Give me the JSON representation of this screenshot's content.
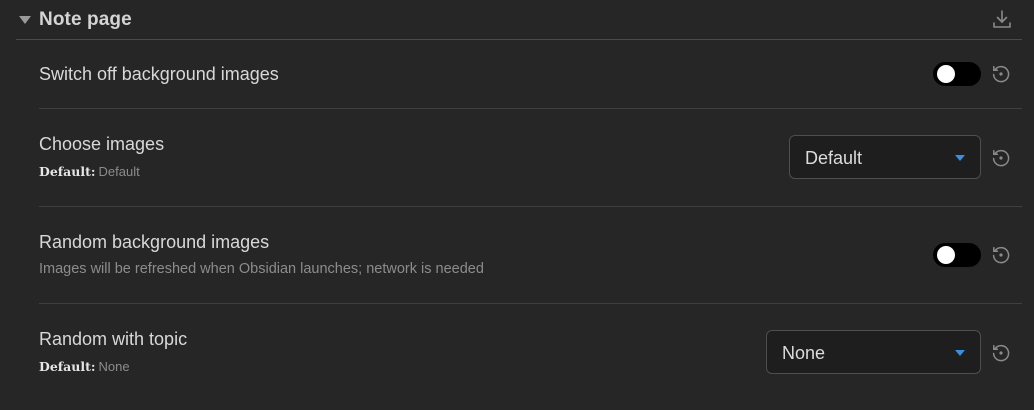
{
  "section": {
    "title": "Note page",
    "collapse_icon": "caret-down-icon",
    "export_icon": "download-icon"
  },
  "settings": [
    {
      "name": "Switch off background images",
      "control": "toggle",
      "enabled": false,
      "reset_icon": "reset-icon"
    },
    {
      "name": "Choose images",
      "default_label": "Default:",
      "default_value": "Default",
      "control": "dropdown",
      "selected": "Default",
      "reset_icon": "reset-icon"
    },
    {
      "name": "Random background images",
      "description": "Images will be refreshed when Obsidian launches; network is needed",
      "control": "toggle",
      "enabled": false,
      "reset_icon": "reset-icon"
    },
    {
      "name": "Random with topic",
      "default_label": "Default:",
      "default_value": "None",
      "control": "dropdown",
      "selected": "None",
      "reset_icon": "reset-icon"
    }
  ],
  "colors": {
    "background": "#262626",
    "toggle_off": "#000000",
    "dropdown_arrow": "#3b8fe0"
  }
}
